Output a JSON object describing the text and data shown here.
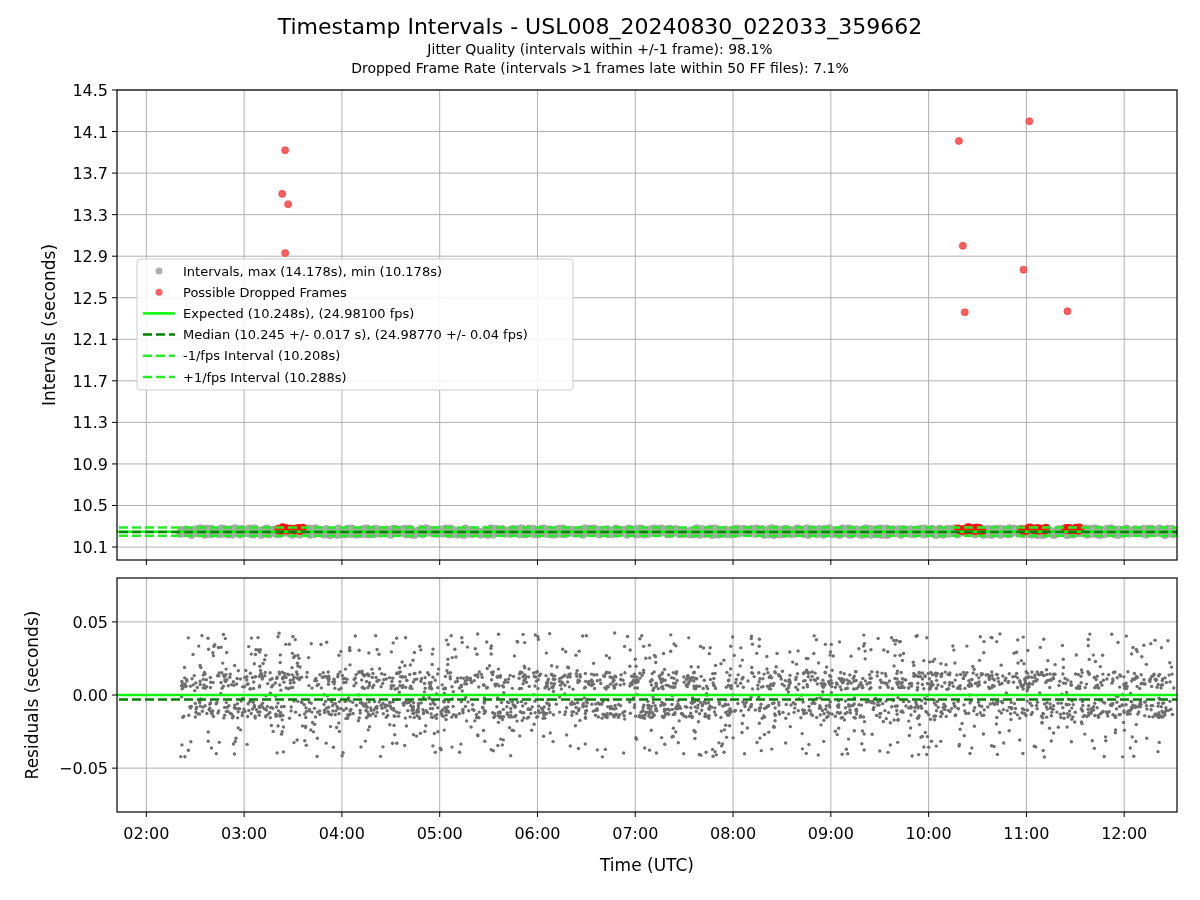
{
  "title": "Timestamp Intervals - USL008_20240830_022033_359662",
  "subtitles": [
    "Jitter Quality (intervals within +/-1 frame): 98.1%",
    "Dropped Frame Rate (intervals >1 frames late within 50 FF files): 7.1%"
  ],
  "intervals_chart": {
    "chart_data": {
      "type": "scatter",
      "ylabel": "Intervals (seconds)",
      "grid": true,
      "legend": "center left",
      "xlim": [
        1.7,
        12.54
      ],
      "ylim": [
        9.975,
        14.5
      ],
      "yticks": [
        {
          "value": 14.5,
          "label": "14.5"
        },
        {
          "value": 14.1,
          "label": "14.1"
        },
        {
          "value": 13.7,
          "label": "13.7"
        },
        {
          "value": 13.3,
          "label": "13.3"
        },
        {
          "value": 12.9,
          "label": "12.9"
        },
        {
          "value": 12.5,
          "label": "12.5"
        },
        {
          "value": 12.1,
          "label": "12.1"
        },
        {
          "value": 11.7,
          "label": "11.7"
        },
        {
          "value": 11.3,
          "label": "11.3"
        },
        {
          "value": 10.9,
          "label": "10.9"
        },
        {
          "value": 10.5,
          "label": "10.5"
        },
        {
          "value": 10.1,
          "label": "10.1"
        }
      ],
      "x": [
        3.42,
        3.39,
        3.45,
        3.42,
        10.31,
        10.35,
        10.37,
        11.03,
        10.97,
        11.42
      ],
      "series": [
        {
          "name": "Possible Dropped Frames",
          "color": "#ff6060",
          "values": [
            13.92,
            13.5,
            13.4,
            12.93,
            14.01,
            13.0,
            12.36,
            14.2,
            12.77,
            12.37
          ]
        }
      ],
      "ref_lines": [
        {
          "axis": "y",
          "value": 10.248,
          "label": "Expected (10.248s), (24.98100 fps)",
          "color": "#00ff00"
        },
        {
          "axis": "y",
          "value": 10.245,
          "label": "Median (10.245 +/- 0.017 s), (24.98770 +/- 0.04 fps)",
          "color": "#008000"
        },
        {
          "axis": "y",
          "value": 10.208,
          "label": "-1/fps Interval (10.208s)",
          "color": "#22ee22"
        },
        {
          "axis": "y",
          "value": 10.288,
          "label": "+1/fps Interval (10.288s)",
          "color": "#22ee22"
        }
      ]
    },
    "intervals_legend": {
      "label": "Intervals, max (14.178s), min (10.178s)",
      "color": "#b0b0b0"
    }
  },
  "residuals_chart": {
    "chart_data": {
      "type": "scatter",
      "xlabel": "Time (UTC)",
      "ylabel": "Residuals (seconds)",
      "grid": true,
      "xlim": [
        1.7,
        12.54
      ],
      "ylim": [
        -0.08,
        0.08
      ],
      "xticks": [
        {
          "value": 2,
          "label": "02:00"
        },
        {
          "value": 3,
          "label": "03:00"
        },
        {
          "value": 4,
          "label": "04:00"
        },
        {
          "value": 5,
          "label": "05:00"
        },
        {
          "value": 6,
          "label": "06:00"
        },
        {
          "value": 7,
          "label": "07:00"
        },
        {
          "value": 8,
          "label": "08:00"
        },
        {
          "value": 9,
          "label": "09:00"
        },
        {
          "value": 10,
          "label": "10:00"
        },
        {
          "value": 11,
          "label": "11:00"
        },
        {
          "value": 12,
          "label": "12:00"
        }
      ],
      "yticks": [
        {
          "value": 0.05,
          "label": "0.05"
        },
        {
          "value": 0,
          "label": "0.00"
        },
        {
          "value": -0.05,
          "label": "−0.05"
        }
      ],
      "ref_lines": [
        {
          "axis": "y",
          "value": 0,
          "color": "#00ff00"
        },
        {
          "axis": "y",
          "value": -0.003,
          "color": "#008000"
        }
      ]
    }
  }
}
